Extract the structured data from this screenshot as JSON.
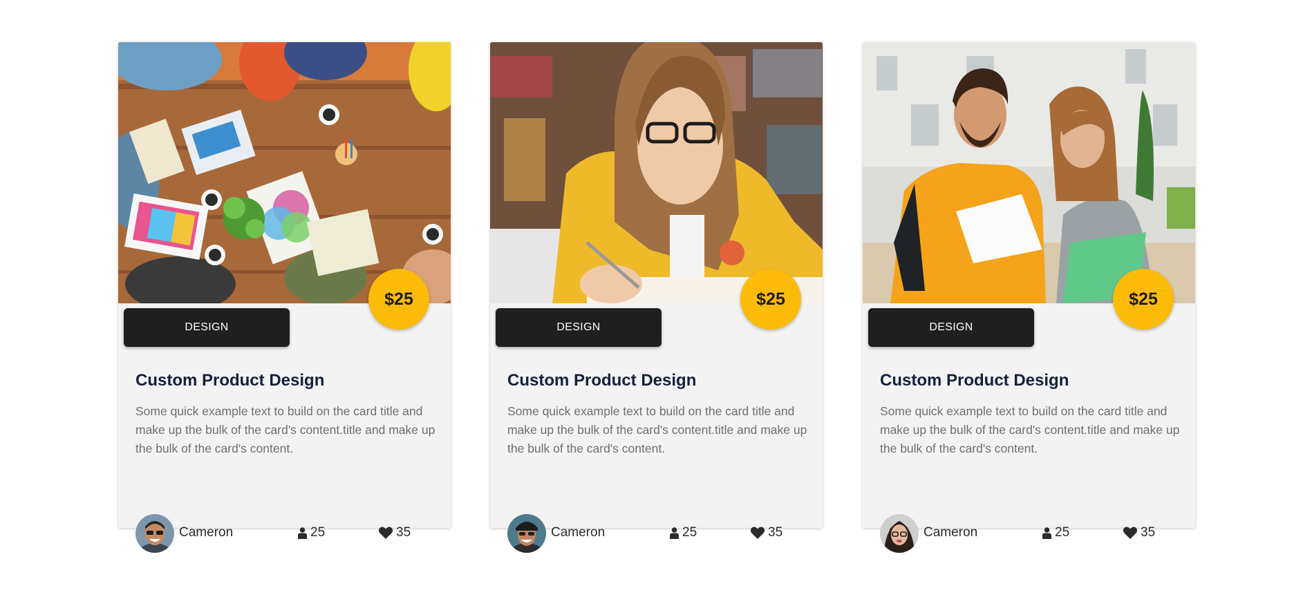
{
  "cards": [
    {
      "price": "$25",
      "category": "DESIGN",
      "title": "Custom Product Design",
      "text": "Some quick example text to build on the card title and make up the bulk of the card's content.title and make up the bulk of the card's content.",
      "author": "Cameron",
      "users": "25",
      "likes": "35",
      "image": "team-desk-photo"
    },
    {
      "price": "$25",
      "category": "DESIGN",
      "title": "Custom Product Design",
      "text": "Some quick example text to build on the card title and make up the bulk of the card's content.title and make up the bulk of the card's content.",
      "author": "Cameron",
      "users": "25",
      "likes": "35",
      "image": "student-writing-photo"
    },
    {
      "price": "$25",
      "category": "DESIGN",
      "title": "Custom Product Design",
      "text": "Some quick example text to build on the card title and make up the bulk of the card's content.title and make up the bulk of the card's content.",
      "author": "Cameron",
      "users": "25",
      "likes": "35",
      "image": "students-outdoor-photo"
    }
  ],
  "colors": {
    "card_bg": "#f3f3f3",
    "price_badge": "#fcbb09",
    "category_button": "#1f1f1f",
    "title": "#14213d",
    "text": "#6f6f6f"
  },
  "icons": {
    "users": "user-icon",
    "likes": "heart-icon"
  }
}
